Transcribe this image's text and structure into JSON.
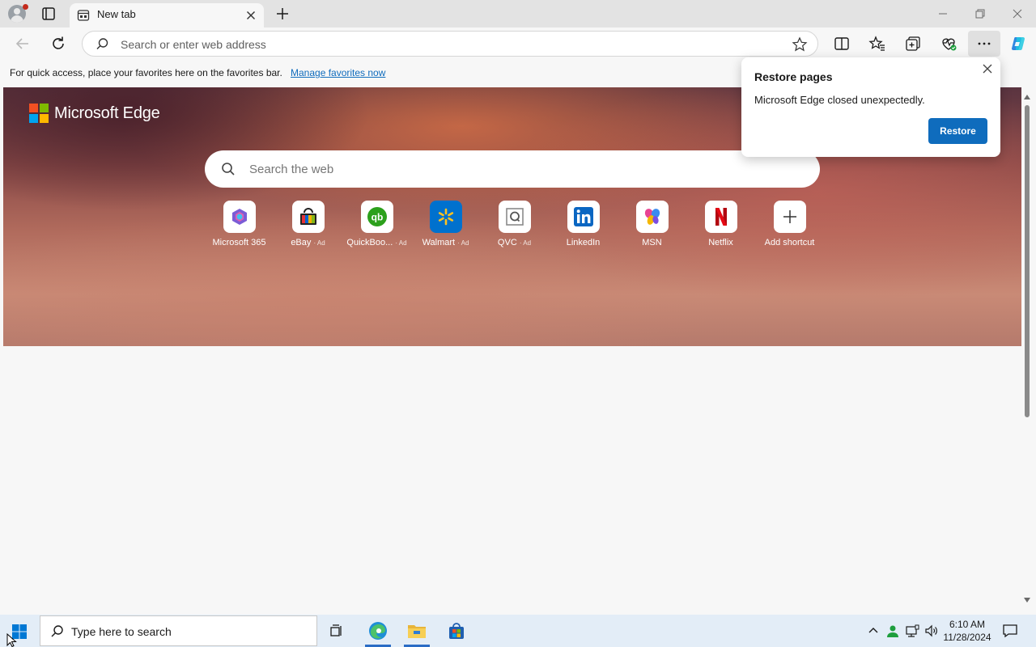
{
  "browser": {
    "tab_title": "New tab",
    "address_placeholder": "Search or enter web address"
  },
  "favorites_bar": {
    "message": "For quick access, place your favorites here on the favorites bar.",
    "link": "Manage favorites now"
  },
  "newtab": {
    "brand": "Microsoft Edge",
    "search_placeholder": "Search the web",
    "shortcuts": [
      {
        "label": "Microsoft 365",
        "ad": "",
        "icon": "microsoft365-icon"
      },
      {
        "label": "eBay",
        "ad": "· Ad",
        "icon": "ebay-icon"
      },
      {
        "label": "QuickBoo...",
        "ad": "· Ad",
        "icon": "quickbooks-icon"
      },
      {
        "label": "Walmart",
        "ad": "· Ad",
        "icon": "walmart-icon"
      },
      {
        "label": "QVC",
        "ad": "· Ad",
        "icon": "qvc-icon"
      },
      {
        "label": "LinkedIn",
        "ad": "",
        "icon": "linkedin-icon"
      },
      {
        "label": "MSN",
        "ad": "",
        "icon": "msn-icon"
      },
      {
        "label": "Netflix",
        "ad": "",
        "icon": "netflix-icon"
      },
      {
        "label": "Add shortcut",
        "ad": "",
        "icon": "plus-icon"
      }
    ]
  },
  "popup": {
    "title": "Restore pages",
    "message": "Microsoft Edge closed unexpectedly.",
    "button": "Restore"
  },
  "taskbar": {
    "search_placeholder": "Type here to search",
    "time": "6:10 AM",
    "date": "11/28/2024"
  },
  "colors": {
    "accent": "#0f6cbd",
    "taskbar": "#e3edf7",
    "logo": [
      "#f25022",
      "#7fba00",
      "#00a4ef",
      "#ffb900"
    ]
  }
}
